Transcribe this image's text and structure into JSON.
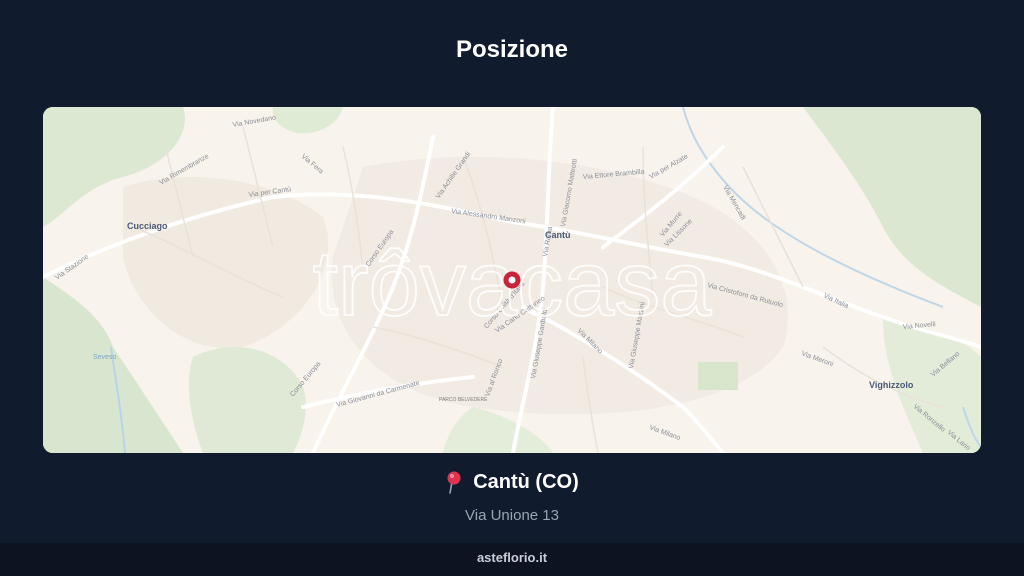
{
  "title": "Posizione",
  "map": {
    "watermark": "trôvacasa",
    "places": [
      "Cucciago",
      "Cantù",
      "Vighizzolo"
    ],
    "poi": "PARCO BELVEDERE",
    "streets": {
      "s1": "Via Novedano",
      "s2": "Via Rimembranze",
      "s3": "Via Fera",
      "s4": "Via per Cantù",
      "s5": "Via Achille Grandi",
      "s6": "Via Alessandro Manzoni",
      "s7": "Corso Europa",
      "s8": "Via Stazione",
      "s9": "Corso Unità d'Italia",
      "s10": "Via Carlo Cattaneo",
      "s11": "Via Ettore Brambilla",
      "s12": "Via per Alzate",
      "s13": "Via Giacomo Matteotti",
      "s14": "Via Milano",
      "s15": "Via Giuseppe Garibaldi",
      "s16": "Via Lissone",
      "s17": "Via Cristoforo da Rutuolo",
      "s18": "Via al Ronco",
      "s19": "Via Giuseppe Mazzini",
      "s20": "Via Milano",
      "s21": "Corso Europa",
      "s22": "Via Giovanni da Carmenate",
      "s23": "Via Roma",
      "s24": "Via Mencadi",
      "s25": "Via Novelli",
      "s26": "Via Meroni",
      "s27": "Via Bellano",
      "s28": "Via Ronzello",
      "s29": "Via Murre",
      "s30": "Seveso",
      "s31": "Via Lario",
      "s32": "Via Italia"
    }
  },
  "location": {
    "pin_icon": "pushpin",
    "city": "Cantù (CO)",
    "address": "Via Unione 13"
  },
  "footer": "asteflorio.it",
  "colors": {
    "background": "#111b2e",
    "footer": "#0c1321",
    "marker": "#c8233a"
  }
}
